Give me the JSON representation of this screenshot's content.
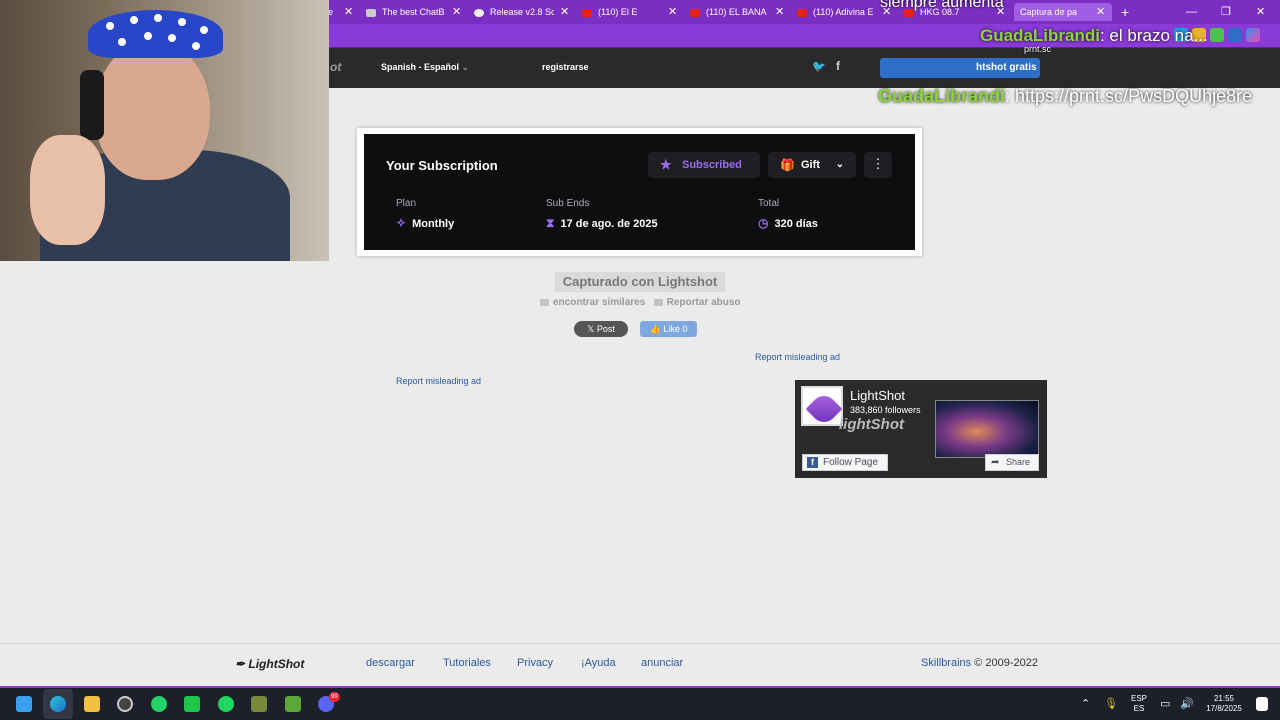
{
  "browser": {
    "tabs": [
      {
        "label": "e"
      },
      {
        "label": "The best ChatB"
      },
      {
        "label": "Release v2.8 Sc"
      },
      {
        "label": "(110) El E"
      },
      {
        "label": "(110) EL BANA"
      },
      {
        "label": "(110) Adivina E"
      },
      {
        "label": "HKG 08.7"
      },
      {
        "label": "Captura de pa"
      }
    ],
    "new_tab": "+",
    "minimize": "—",
    "restore": "❐",
    "close": "✕"
  },
  "site": {
    "logo_fragment": "ot",
    "language": "Spanish - Español",
    "register": "registrarse",
    "download_btn": "htshot gratis"
  },
  "stream_chat": {
    "top_text": "siempre aumenta",
    "line1_user": "GuadaLibrandi",
    "line1_text": ": el brazo na...",
    "line2_user": "GuadaLibrandi",
    "line2_text": ": https://prnt.sc/PwsDQUhje8re",
    "small_text": "prnt.sc"
  },
  "subscription": {
    "title": "Your Subscription",
    "subscribed_btn": "Subscribed",
    "gift_btn": "Gift",
    "more_btn": "⋮",
    "plan_label": "Plan",
    "plan_value": "Monthly",
    "ends_label": "Sub Ends",
    "ends_value": "17 de ago. de 2025",
    "total_label": "Total",
    "total_value": "320 días",
    "accent_color": "#9a6cf0"
  },
  "lightshot": {
    "captured": "Capturado con Lightshot",
    "find_similar": "encontrar similares",
    "report_abuse": "Reportar abuso",
    "post_btn": "Post",
    "like_btn": "Like 0",
    "report_ad_right": "Report misleading ad",
    "report_ad_left": "Report misleading ad"
  },
  "fb_widget": {
    "page_name": "LightShot",
    "followers": "383,860 followers",
    "brand": "lightShot",
    "follow_btn": "Follow Page",
    "share_btn": "Share"
  },
  "footer": {
    "logo": "LightShot",
    "links": [
      "descargar",
      "Tutoriales",
      "Privacy",
      "¡Ayuda",
      "anunciar"
    ],
    "company": "Skillbrains",
    "copyright": "© 2009-2022"
  },
  "taskbar": {
    "lang_top": "ESP",
    "lang_bottom": "ES",
    "time": "21:55",
    "date": "17/8/2025",
    "badge": "99"
  }
}
